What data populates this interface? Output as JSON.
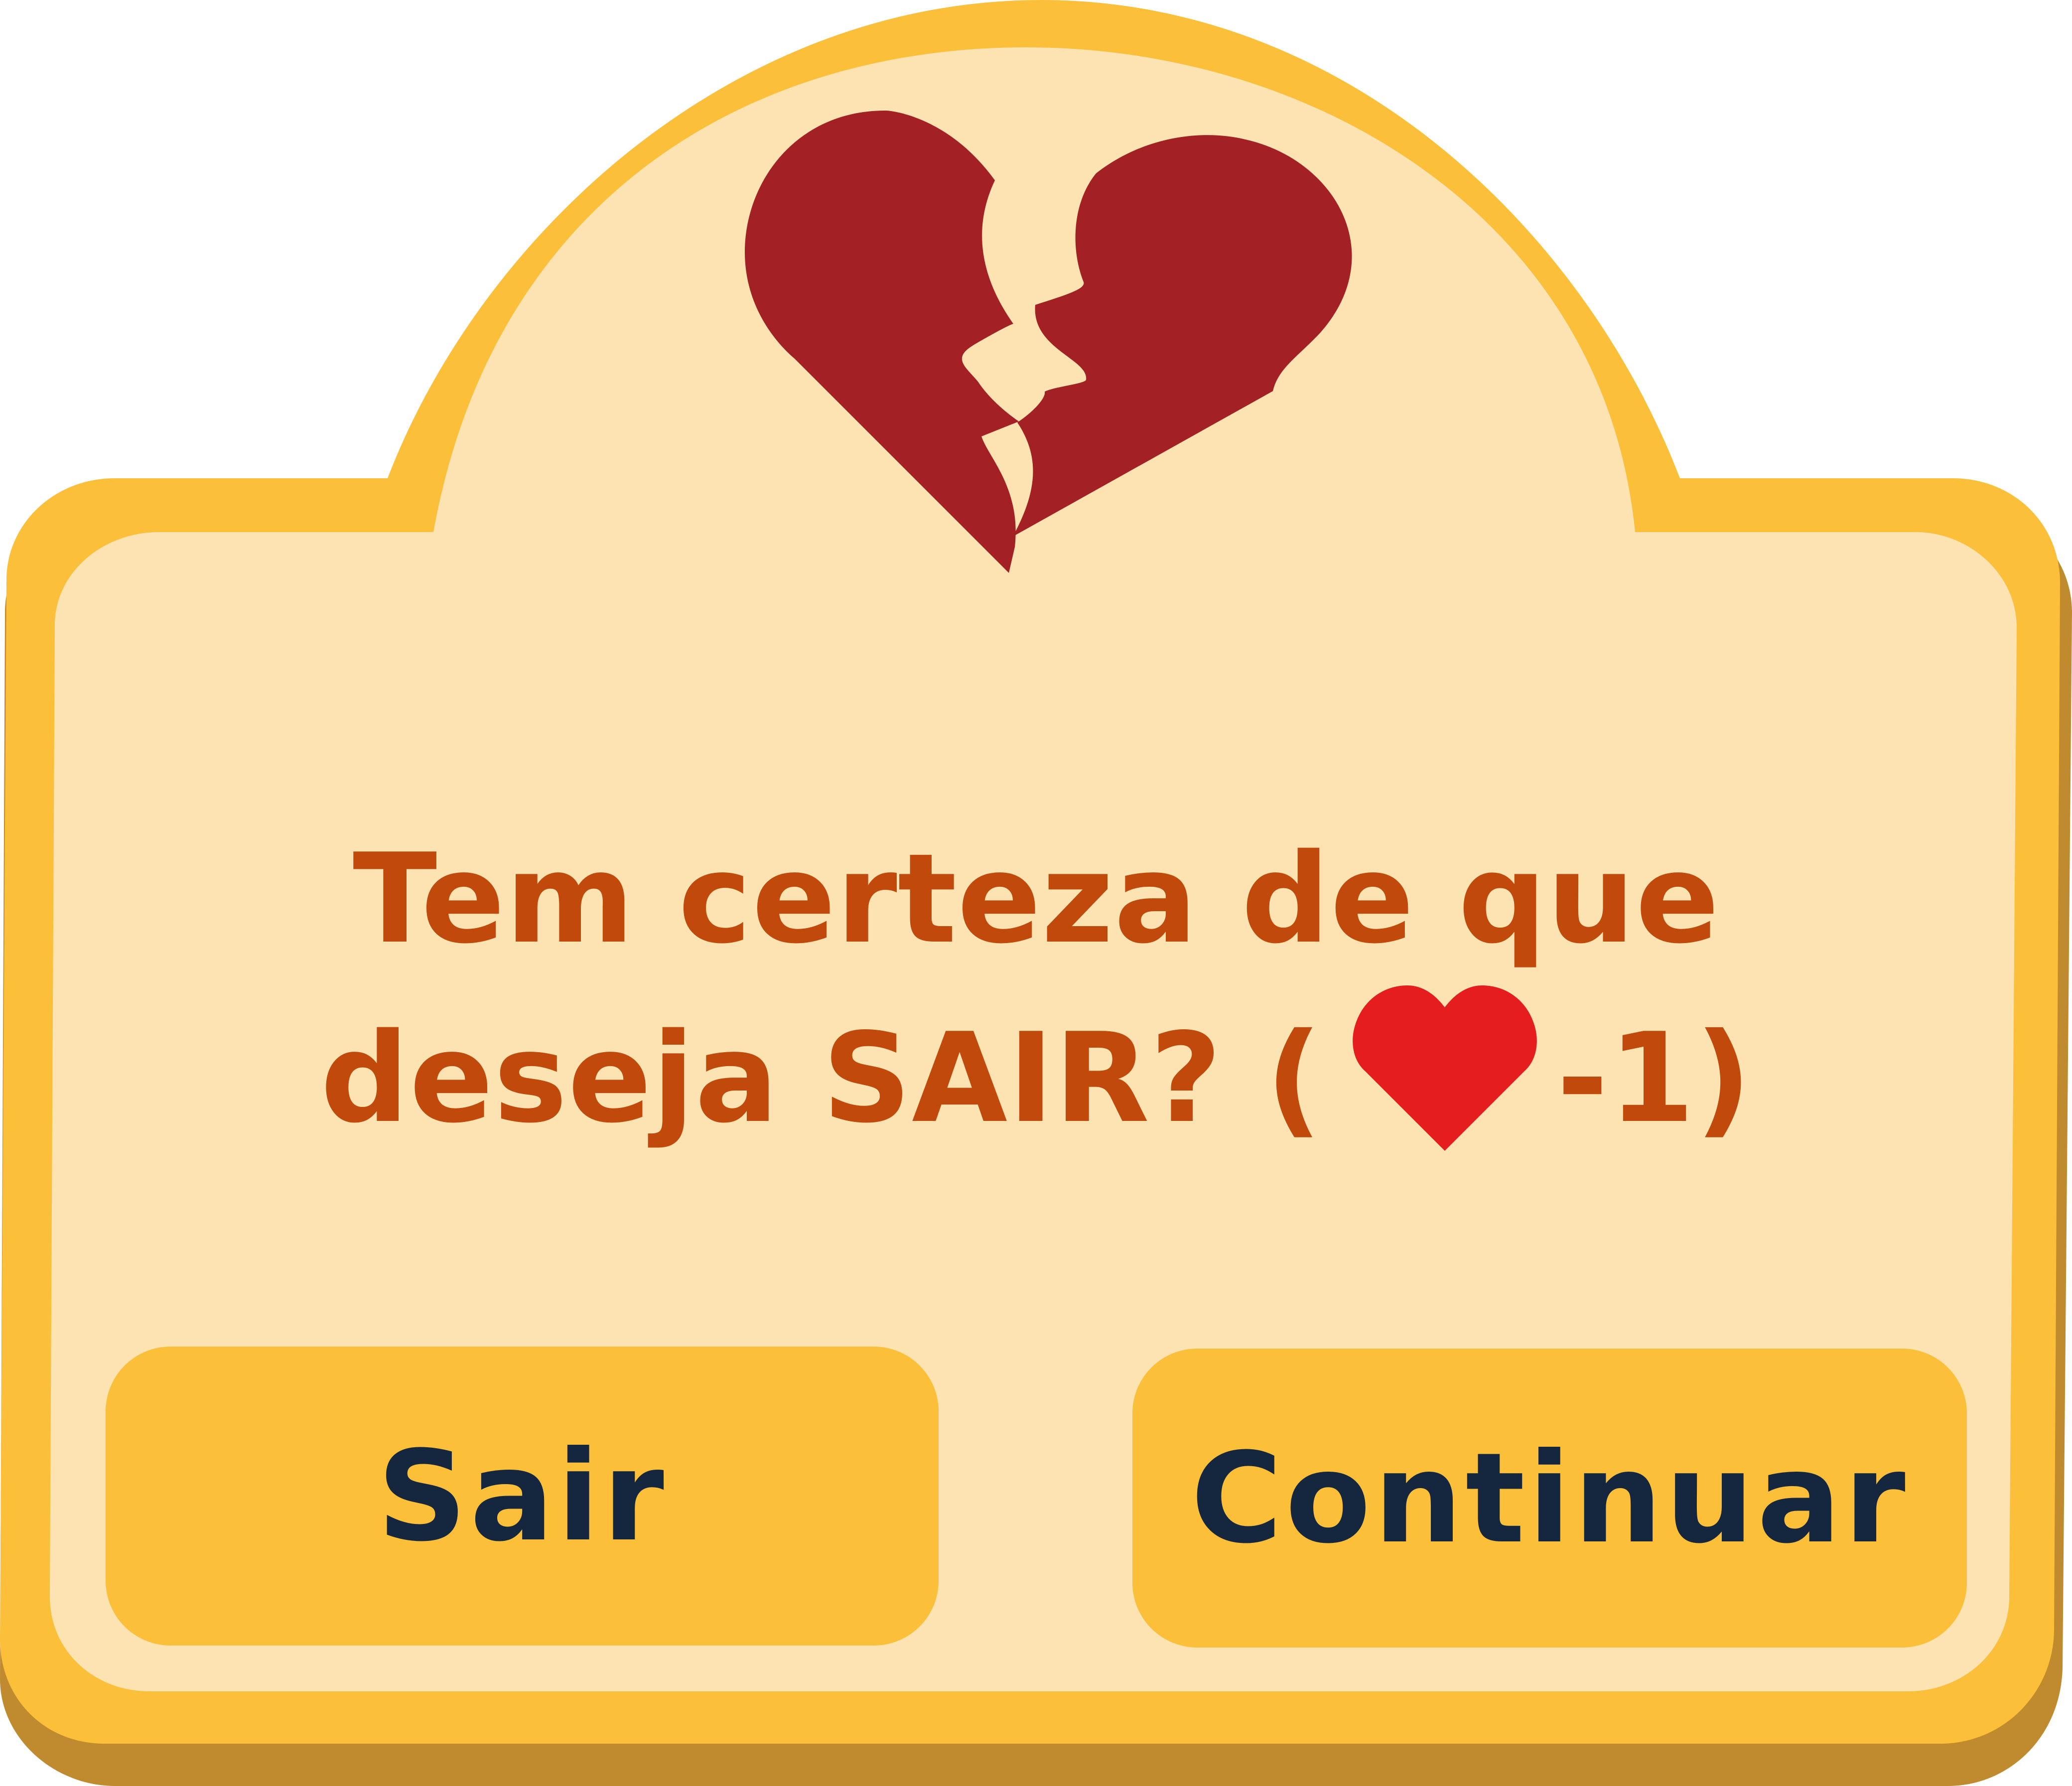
{
  "dialog": {
    "top_icon": "broken-heart-icon",
    "message_line1": "Tem certeza de que",
    "message_line2_text": "deseja SAIR? (",
    "message_heart_icon": "heart-icon",
    "message_cost": "-1)"
  },
  "buttons": {
    "exit_label": "Sair",
    "continue_label": "Continuar"
  },
  "colors": {
    "frame": "#fbbf3a",
    "frame_shadow": "#c08a2e",
    "panel": "#fce3b1",
    "broken_heart": "#a32024",
    "heart": "#e51d1e",
    "message_text": "#c1490b",
    "button_text": "#14273e"
  }
}
